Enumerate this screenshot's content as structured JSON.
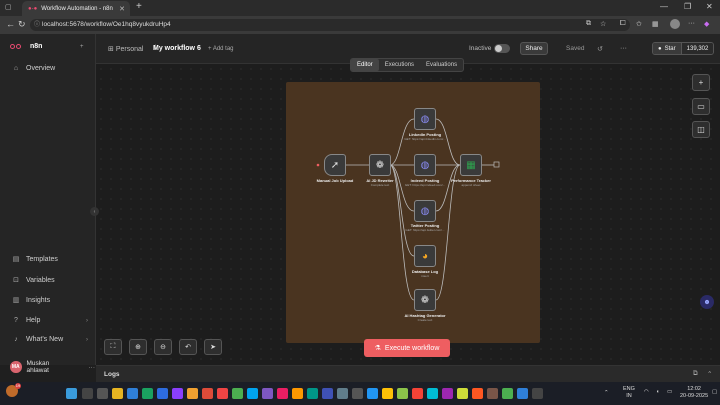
{
  "browser": {
    "tab_title": "Workflow Automation - n8n",
    "url": "localhost:5678/workflow/Oe1hq8vyukdruHp4"
  },
  "sidebar": {
    "logo_text": "n8n",
    "items": [
      {
        "label": "Overview",
        "icon": "home-icon"
      },
      {
        "label": "Templates",
        "icon": "templates-icon"
      },
      {
        "label": "Variables",
        "icon": "variables-icon"
      },
      {
        "label": "Insights",
        "icon": "insights-icon"
      },
      {
        "label": "Help",
        "icon": "help-icon"
      },
      {
        "label": "What's New",
        "icon": "bell-icon"
      }
    ],
    "user": {
      "initials": "MA",
      "name": "Muskan ahlawat"
    }
  },
  "header": {
    "project": "Personal",
    "workflow_name": "My workflow 6",
    "add_tag": "+ Add tag",
    "status_label": "Inactive",
    "share_label": "Share",
    "saved_label": "Saved",
    "star_label": "Star",
    "star_count": "139,302"
  },
  "editor_tabs": [
    "Editor",
    "Executions",
    "Evaluations"
  ],
  "nodes": [
    {
      "name": "Manual Job Upload",
      "sub": ""
    },
    {
      "name": "AI JD Rewriter",
      "sub": "Complete text"
    },
    {
      "name": "LinkedIn Posting",
      "sub": "GET: https://api.linkedin.com/..."
    },
    {
      "name": "Indeed Posting",
      "sub": "GET: https://api.indeed.com/..."
    },
    {
      "name": "Twitter Posting",
      "sub": "GET: https://api.twitter.com/..."
    },
    {
      "name": "Database Log",
      "sub": "insert"
    },
    {
      "name": "AI Hashtag Generator",
      "sub": "Create text"
    },
    {
      "name": "Performance Tracker",
      "sub": "append: sheet"
    }
  ],
  "execute_label": "Execute workflow",
  "logs_label": "Logs",
  "taskbar": {
    "lang": "ENG",
    "region": "IN",
    "time": "12:02",
    "date": "20-09-2025",
    "badge": "19"
  },
  "colors": {
    "accent": "#ee5e61",
    "sticky": "#4a3420",
    "brand": "#ea4b71"
  }
}
